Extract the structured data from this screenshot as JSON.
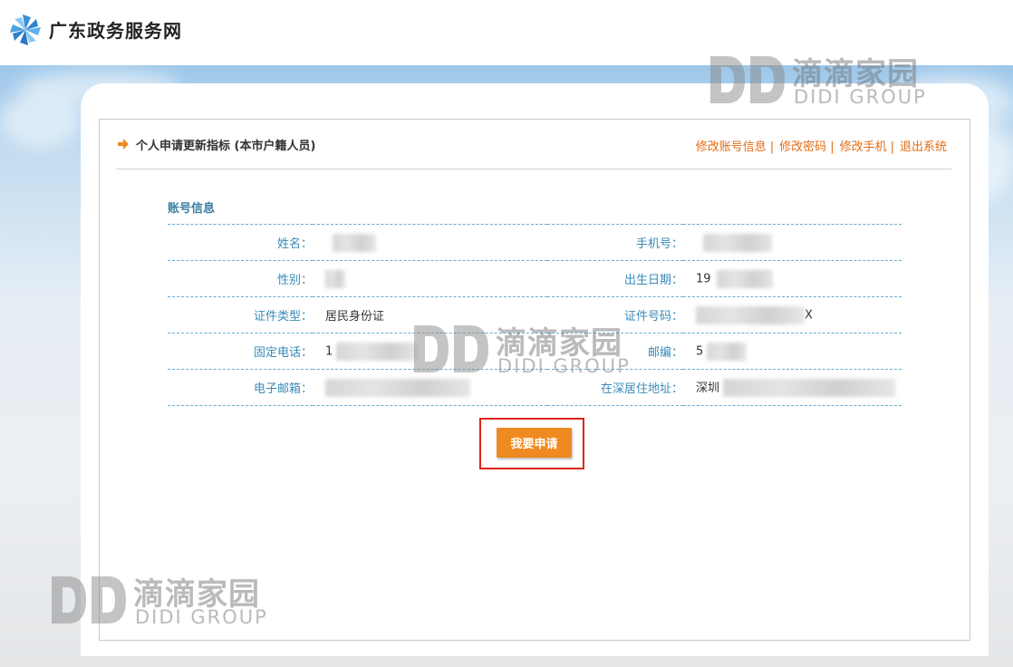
{
  "header": {
    "site_title": "广东政务服务网",
    "logo_icon": "pinwheel-logo-icon"
  },
  "panel": {
    "title": "个人申请更新指标 (本市户籍人员)",
    "links": [
      "修改账号信息",
      "修改密码",
      "修改手机",
      "退出系统"
    ],
    "link_separator": "|"
  },
  "account": {
    "section_title": "账号信息",
    "rows": [
      {
        "left_label": "姓名：",
        "left_value": "",
        "right_label": "手机号：",
        "right_value": ""
      },
      {
        "left_label": "性别：",
        "left_value": "",
        "right_label": "出生日期：",
        "right_value": "19"
      },
      {
        "left_label": "证件类型：",
        "left_value": "居民身份证",
        "right_label": "证件号码：",
        "right_value": "X"
      },
      {
        "left_label": "固定电话：",
        "left_value": "1",
        "right_label": "邮编：",
        "right_value": "5"
      },
      {
        "left_label": "电子邮箱：",
        "left_value": "",
        "right_label": "在深居住地址：",
        "right_value": "深圳"
      }
    ]
  },
  "apply_button": {
    "label": "我要申请"
  },
  "watermark": {
    "letters": "DD",
    "cn": "滴滴家园",
    "en": "DIDI GROUP"
  },
  "colors": {
    "accent": "#ee8a1f",
    "link": "#e36b12",
    "label": "#3a8ab8",
    "highlight": "#e0241b"
  }
}
